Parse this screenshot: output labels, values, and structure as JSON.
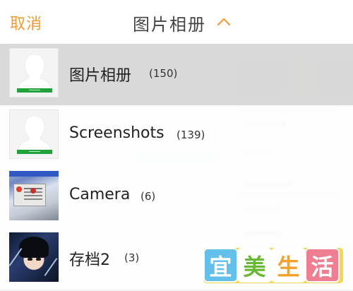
{
  "header": {
    "cancel_label": "取消",
    "title": "图片相册",
    "toggle_icon": "chevron-up-icon"
  },
  "albums": [
    {
      "name": "图片相册",
      "count": "(150)",
      "selected": true,
      "thumb": "placeholder-avatar"
    },
    {
      "name": "Screenshots",
      "count": "(139)",
      "selected": false,
      "thumb": "placeholder-avatar"
    },
    {
      "name": "Camera",
      "count": "(6)",
      "selected": false,
      "thumb": "camera-photo"
    },
    {
      "name": "存档2",
      "count": "(3)",
      "selected": false,
      "thumb": "anime-photo"
    }
  ],
  "watermark": {
    "chars": [
      "宜",
      "美",
      "生",
      "活"
    ]
  },
  "colors": {
    "accent": "#f29a33",
    "selected_row": "#d7d7d7",
    "green_bar": "#1fa33a"
  }
}
